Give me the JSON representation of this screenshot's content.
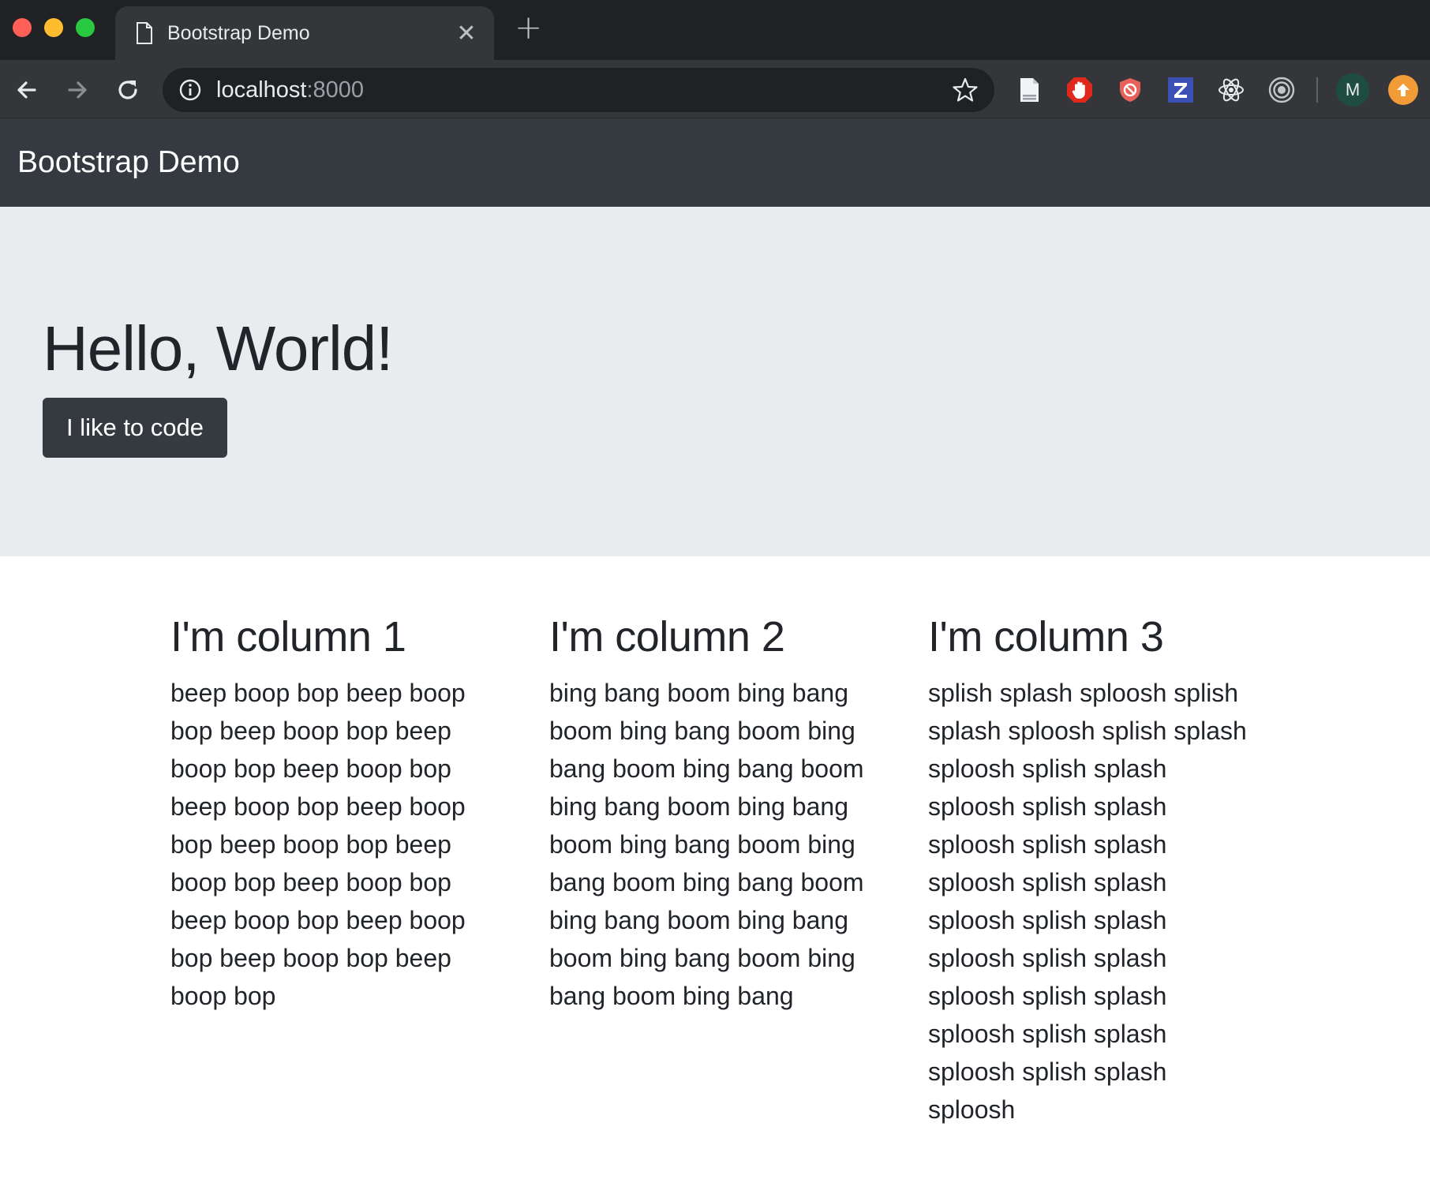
{
  "browser": {
    "tab_title": "Bootstrap Demo",
    "url_host": "localhost",
    "url_port": ":8000",
    "profile_initial": "M",
    "colors": {
      "chrome_dark": "#202124",
      "chrome_toolbar": "#35363a"
    },
    "extensions": [
      "docs-offline-icon",
      "adblock-hand-icon",
      "shield-block-icon",
      "z-extension-icon",
      "react-devtools-icon",
      "target-icon"
    ]
  },
  "navbar": {
    "brand": "Bootstrap Demo",
    "color": "#343a40"
  },
  "jumbotron": {
    "heading": "Hello, World!",
    "button_label": "I like to code",
    "background": "#e9ecef"
  },
  "columns": [
    {
      "heading": "I'm column 1",
      "text": "beep boop bop beep boop bop beep boop bop beep boop bop beep boop bop beep boop bop beep boop bop beep boop bop beep boop bop beep boop bop beep boop bop beep boop bop beep boop bop beep boop bop"
    },
    {
      "heading": "I'm column 2",
      "text": "bing bang boom bing bang boom bing bang boom bing bang boom bing bang boom bing bang boom bing bang boom bing bang boom bing bang boom bing bang boom bing bang boom bing bang boom bing bang boom bing bang boom bing bang"
    },
    {
      "heading": "I'm column 3",
      "text": "splish splash sploosh splish splash sploosh splish splash sploosh splish splash sploosh splish splash sploosh splish splash sploosh splish splash sploosh splish splash sploosh splish splash sploosh splish splash sploosh splish splash sploosh splish splash sploosh"
    }
  ]
}
